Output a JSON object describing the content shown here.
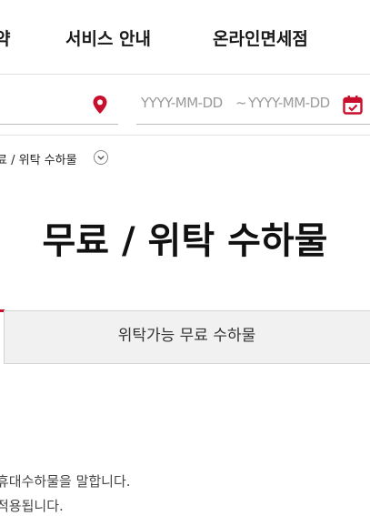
{
  "nav": {
    "items": [
      {
        "label": "약"
      },
      {
        "label": "서비스 안내"
      },
      {
        "label": "온라인면세점"
      }
    ]
  },
  "search": {
    "date_start_placeholder": "YYYY-MM-DD",
    "date_separator": "~",
    "date_end_placeholder": "YYYY-MM-DD"
  },
  "breadcrumb": {
    "current": "료 / 위탁 수하물"
  },
  "page": {
    "title": "무료 / 위탁 수하물"
  },
  "tabs": [
    {
      "label": "위탁가능 무료 수하물"
    }
  ],
  "content": {
    "line1": "휴대수하물을 말합니다.",
    "line2": "적용됩니다."
  },
  "colors": {
    "accent": "#c8102e"
  }
}
